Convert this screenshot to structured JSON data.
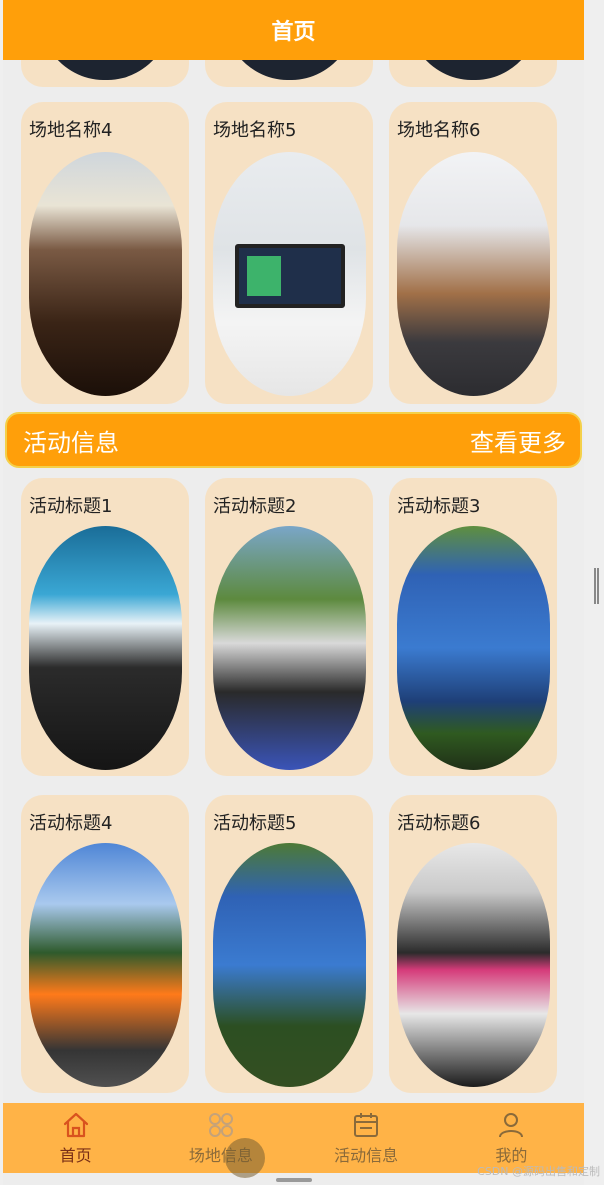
{
  "header": {
    "title": "首页"
  },
  "venues": {
    "items": [
      {
        "title": "场地名称4"
      },
      {
        "title": "场地名称5"
      },
      {
        "title": "场地名称6"
      }
    ]
  },
  "activities_section": {
    "title": "活动信息",
    "more": "查看更多"
  },
  "activities": {
    "items": [
      {
        "title": "活动标题1"
      },
      {
        "title": "活动标题2"
      },
      {
        "title": "活动标题3"
      },
      {
        "title": "活动标题4"
      },
      {
        "title": "活动标题5"
      },
      {
        "title": "活动标题6"
      }
    ]
  },
  "tabbar": {
    "items": [
      {
        "label": "首页",
        "icon": "home-icon"
      },
      {
        "label": "场地信息",
        "icon": "grid-icon"
      },
      {
        "label": "活动信息",
        "icon": "calendar-icon"
      },
      {
        "label": "我的",
        "icon": "user-icon"
      }
    ]
  },
  "watermark": "CSDN @源码出售和定制",
  "colors": {
    "header": "#ff9f0a",
    "card": "#f6e1c4",
    "tabbar": "#ffb347",
    "active_tab": "#7a2f16"
  }
}
